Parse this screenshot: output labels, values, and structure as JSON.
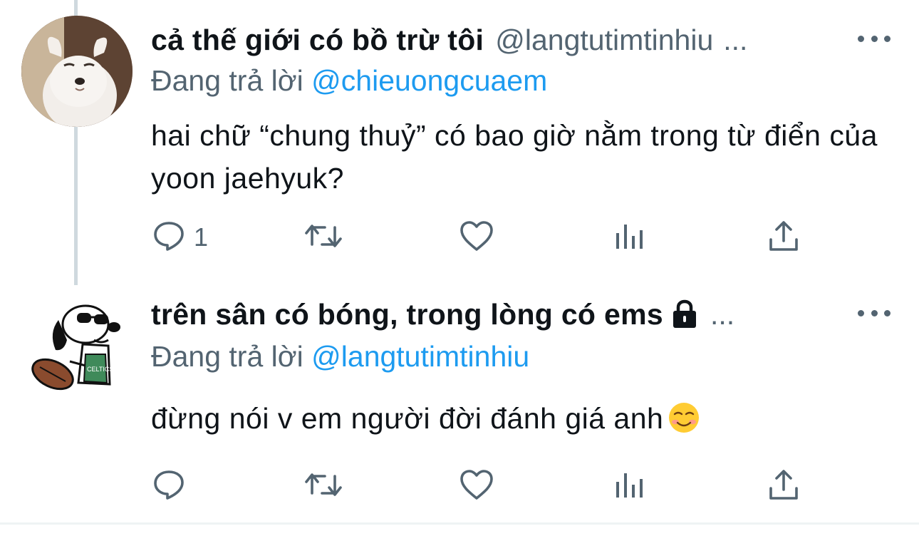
{
  "tweets": [
    {
      "display_name": "cả thế giới có bồ trừ tôi",
      "handle": "@langtutimtinhiu",
      "ellipsis": "...",
      "reply_prefix": "Đang trả lời",
      "reply_to": "@chieuongcuaem",
      "text": "hai chữ “chung thuỷ” có bao giờ nằm trong từ điển của yoon jaehyuk?",
      "reply_count": "1",
      "avatar": "white-chihuahua-avatar",
      "locked": false
    },
    {
      "display_name": "trên sân có bóng, trong lòng có ems",
      "handle": "",
      "ellipsis": "...",
      "reply_prefix": "Đang trả lời",
      "reply_to": "@langtutimtinhiu",
      "text": "đừng nói v em người đời đánh giá anh",
      "emoji": "☺️",
      "reply_count": "",
      "avatar": "snoopy-celtics-avatar",
      "locked": true
    }
  ],
  "icons": {
    "reply": "reply-icon",
    "retweet": "retweet-icon",
    "like": "heart-icon",
    "analytics": "analytics-icon",
    "share": "share-icon",
    "more": "more-icon",
    "lock": "lock-icon"
  },
  "colors": {
    "text": "#0f1419",
    "secondary": "#536471",
    "link": "#1d9bf0",
    "thread_line": "#cfd9de",
    "divider": "#eff3f4"
  }
}
